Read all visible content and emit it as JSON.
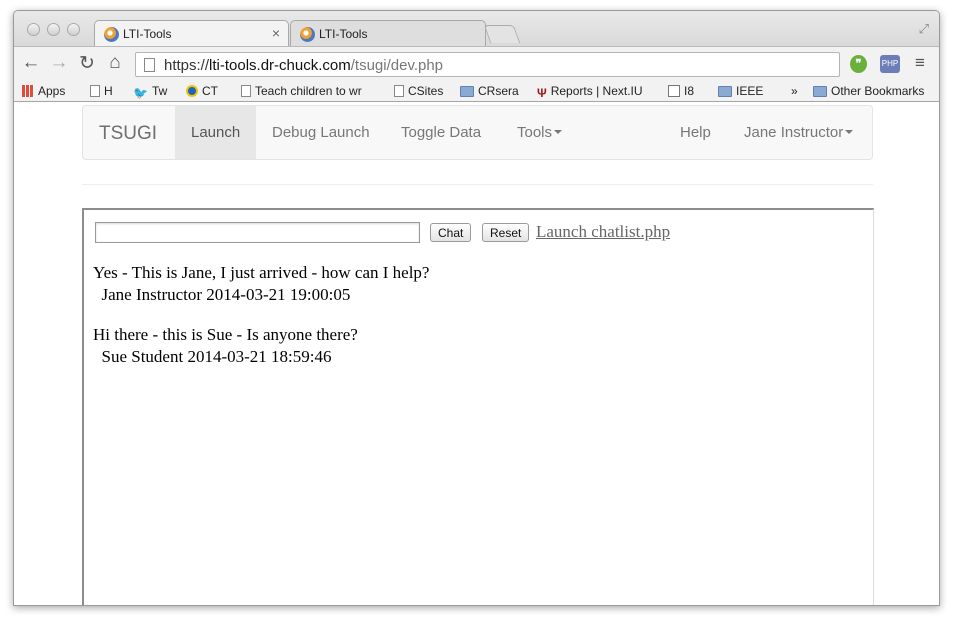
{
  "browser": {
    "tabs": [
      {
        "title": "LTI-Tools",
        "close": "×"
      },
      {
        "title": "LTI-Tools"
      }
    ],
    "url": {
      "scheme": "https://",
      "host": "lti-tools.dr-chuck.com",
      "path": "/tsugi/dev.php"
    },
    "nav_icons": {
      "back": "←",
      "forward": "→",
      "reload": "↻",
      "home": "⌂",
      "menu": "≡",
      "fullscreen": "⤢"
    },
    "extensions": {
      "evernote": "❞",
      "php": "PHP"
    },
    "bookmarks": [
      {
        "label": "Apps",
        "icon": "apps-icon"
      },
      {
        "label": "H",
        "icon": "page-icon"
      },
      {
        "label": "Tw",
        "icon": "twitter-icon"
      },
      {
        "label": "CT",
        "icon": "ct-icon"
      },
      {
        "label": "Teach children to wr",
        "icon": "page-icon"
      },
      {
        "label": "CSites",
        "icon": "page-icon"
      },
      {
        "label": "CRsera",
        "icon": "folder-icon"
      },
      {
        "label": "Reports | Next.IU",
        "icon": "iu-icon"
      },
      {
        "label": "I8",
        "icon": "i8-icon"
      },
      {
        "label": "IEEE",
        "icon": "folder-icon"
      },
      {
        "label": "»",
        "icon": ""
      },
      {
        "label": "Other Bookmarks",
        "icon": "folder-icon"
      }
    ]
  },
  "navbar": {
    "brand": "TSUGI",
    "items": [
      "Launch",
      "Debug Launch",
      "Toggle Data",
      "Tools"
    ],
    "right": [
      "Help",
      "Jane Instructor"
    ]
  },
  "chat": {
    "input_value": "",
    "chat_button": "Chat",
    "reset_button": "Reset",
    "launch_link": "Launch chatlist.php",
    "messages": [
      {
        "text": "Yes - This is Jane, I just arrived - how can I help?",
        "meta": "  Jane Instructor 2014-03-21 19:00:05"
      },
      {
        "text": "Hi there - this is Sue - Is anyone there?",
        "meta": "  Sue Student 2014-03-21 18:59:46"
      }
    ]
  },
  "colors": {
    "navbar_bg": "#f8f8f8",
    "active_tab": "#e7e7e7",
    "link": "#666666"
  }
}
